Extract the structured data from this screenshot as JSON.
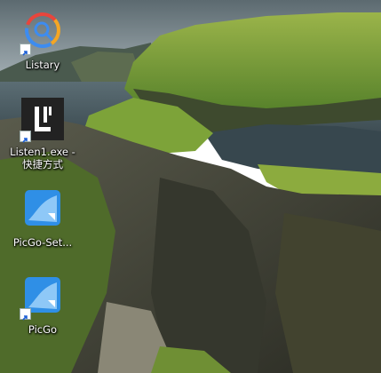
{
  "desktop": {
    "icons": [
      {
        "label": "Listary",
        "icon": "listary-icon",
        "shortcut": true
      },
      {
        "label": "Listen1.exe - 快捷方式",
        "icon": "listen1-icon",
        "shortcut": true
      },
      {
        "label": "PicGo-Set...",
        "icon": "picgo-setup-icon",
        "shortcut": false
      },
      {
        "label": "PicGo",
        "icon": "picgo-icon",
        "shortcut": true
      }
    ]
  },
  "colors": {
    "sky": "#7a8b93",
    "sea": "#4f6169",
    "grass": "#5f8c2e",
    "rock": "#3e3f33",
    "picgo_blue": "#2f8fe6"
  }
}
